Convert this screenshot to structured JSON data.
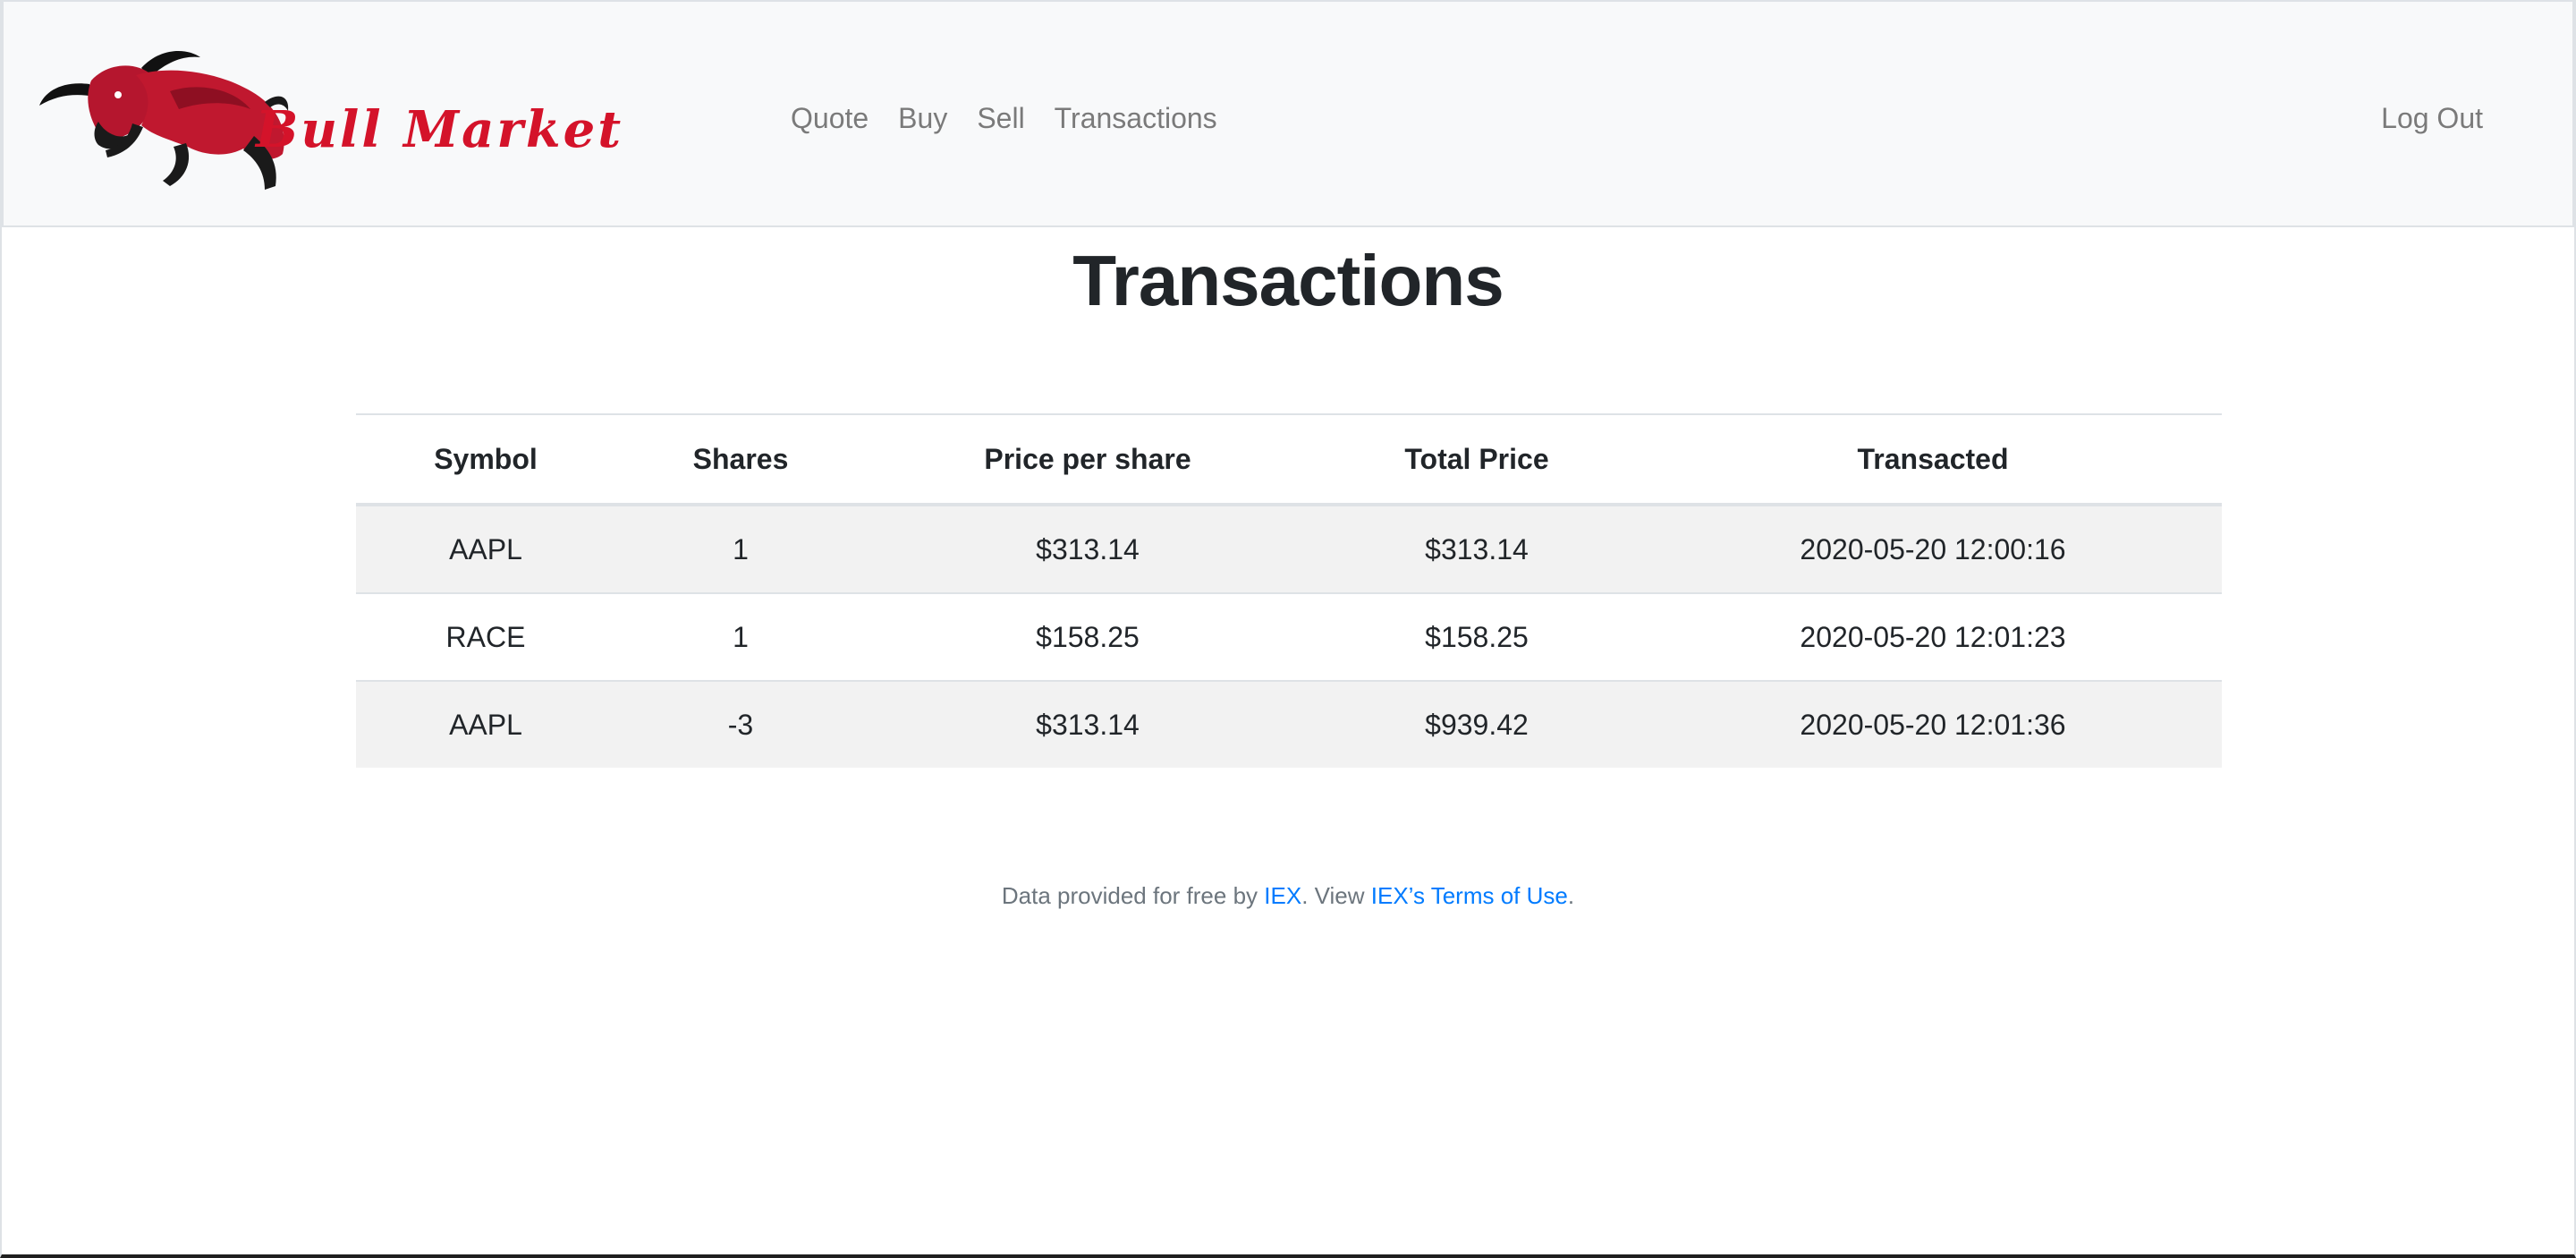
{
  "brand": {
    "name": "Bull Market",
    "logo_icon": "bull-icon",
    "brand_color": "#d4132a"
  },
  "nav": {
    "items": [
      {
        "label": "Quote"
      },
      {
        "label": "Buy"
      },
      {
        "label": "Sell"
      },
      {
        "label": "Transactions"
      }
    ],
    "logout_label": "Log Out"
  },
  "main": {
    "title": "Transactions",
    "table": {
      "headers": [
        "Symbol",
        "Shares",
        "Price per share",
        "Total Price",
        "Transacted"
      ],
      "rows": [
        [
          "AAPL",
          "1",
          "$313.14",
          "$313.14",
          "2020-05-20 12:00:16"
        ],
        [
          "RACE",
          "1",
          "$158.25",
          "$158.25",
          "2020-05-20 12:01:23"
        ],
        [
          "AAPL",
          "-3",
          "$313.14",
          "$939.42",
          "2020-05-20 12:01:36"
        ]
      ]
    }
  },
  "footer": {
    "prefix": "Data provided for free by ",
    "iex_link": "IEX",
    "middle": ". View ",
    "terms_link": "IEX’s Terms of Use",
    "suffix": ".",
    "link_color": "#007bff"
  }
}
